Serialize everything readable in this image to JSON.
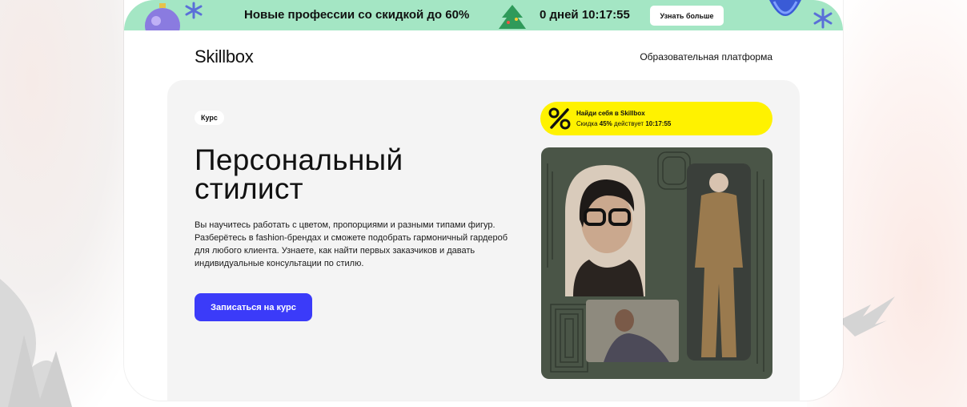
{
  "promo": {
    "text": "Новые профессии со скидкой до 60%",
    "timer": "0 дней 10:17:55",
    "button_label": "Узнать больше"
  },
  "header": {
    "logo": "Skillbox",
    "nav_link": "Образовательная платформа"
  },
  "hero": {
    "badge": "Курс",
    "title": "Персональный стилист",
    "description": "Вы научитесь работать с цветом, пропорциями и разными типами фигур. Разберётесь в fashion-брендах и сможете подобрать гармоничный гардероб для любого клиента. Узнаете, как найти первых заказчиков и давать индивидуальные консультации по стилю.",
    "cta_label": "Записаться на курс"
  },
  "discount": {
    "title": "Найди себя в Skillbox",
    "sub_prefix": "Скидка ",
    "percent": "45%",
    "sub_middle": " действует ",
    "timer": "10:17:55",
    "icon": "percent-icon"
  },
  "colors": {
    "promo_bg": "#a4e6c4",
    "accent": "#3b3bf9",
    "discount_bg": "#fff200",
    "collage_bg": "#4a5547"
  }
}
